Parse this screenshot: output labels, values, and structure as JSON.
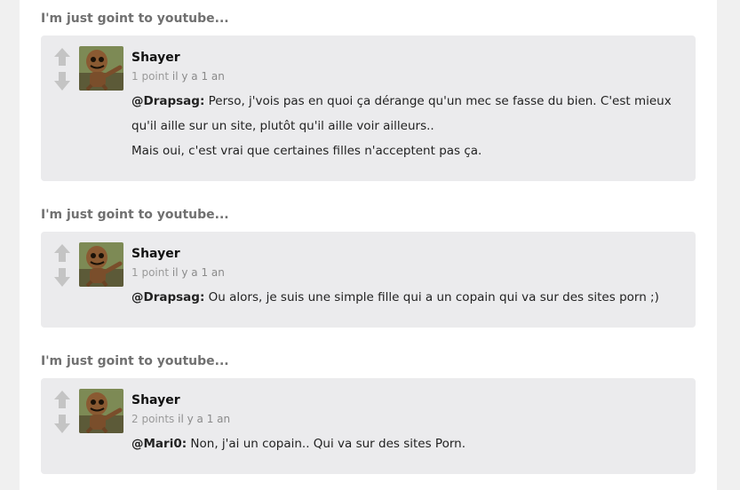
{
  "threads": [
    {
      "title": "I'm just goint to youtube...",
      "comment": {
        "author": "Shayer",
        "points": "1 point",
        "time": "il y a 1 an",
        "mention": "@Drapsag:",
        "lines": [
          " Perso, j'vois pas en quoi ça dérange qu'un mec se fasse du bien. C'est mieux qu'il aille sur un site, plutôt qu'il aille voir ailleurs..",
          "Mais oui, c'est vrai que certaines filles n'acceptent pas ça."
        ]
      }
    },
    {
      "title": "I'm just goint to youtube...",
      "comment": {
        "author": "Shayer",
        "points": "1 point",
        "time": "il y a 1 an",
        "mention": "@Drapsag:",
        "lines": [
          " Ou alors, je suis une simple fille qui a un copain qui va sur des sites porn ;)"
        ]
      }
    },
    {
      "title": "I'm just goint to youtube...",
      "comment": {
        "author": "Shayer",
        "points": "2 points",
        "time": "il y a 1 an",
        "mention": "@Mari0:",
        "lines": [
          " Non, j'ai un copain.. Qui va sur des sites Porn."
        ]
      }
    }
  ],
  "icons": {
    "upvote": "arrow-up-icon",
    "downvote": "arrow-down-icon",
    "avatar": "sackboy-avatar"
  },
  "colors": {
    "box_bg": "#ebebed",
    "title": "#707070",
    "meta": "#8a8a8a",
    "vote_arrow": "#c4c4c4"
  }
}
